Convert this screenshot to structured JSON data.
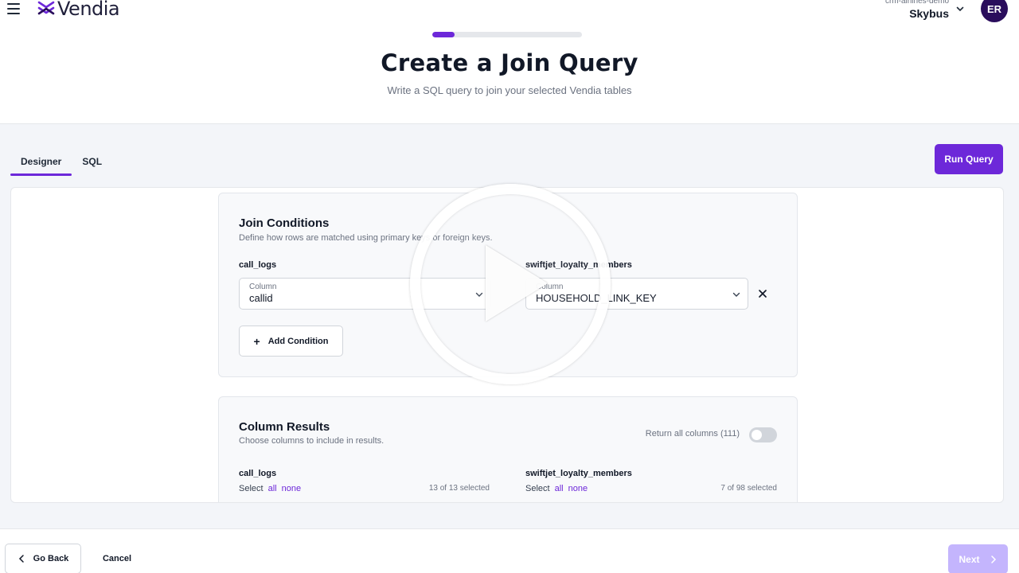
{
  "header": {
    "brand": "Vendia",
    "org_sub": "crm-airlines-demo",
    "org_name": "Skybus",
    "avatar_initials": "ER",
    "icons": {
      "menu": "hamburger-icon",
      "org_dropdown": "chevron-down-icon"
    }
  },
  "wizard": {
    "progress_fraction": 0.15,
    "title": "Create a Join Query",
    "subtitle": "Write a SQL query to join your selected Vendia tables"
  },
  "tabs": [
    {
      "label": "Designer",
      "active": true
    },
    {
      "label": "SQL",
      "active": false
    }
  ],
  "toolbar": {
    "run_label": "Run Query"
  },
  "join_conditions": {
    "title": "Join Conditions",
    "description": "Define how rows are matched using primary keys or foreign keys.",
    "left_table": "call_logs",
    "right_table": "swiftjet_loyalty_members",
    "conditions": [
      {
        "left": {
          "label": "Column",
          "value": "callid"
        },
        "right": {
          "label": "Column",
          "value": "HOUSEHOLD_LINK_KEY"
        }
      }
    ],
    "add_label": "Add Condition"
  },
  "column_results": {
    "title": "Column Results",
    "description": "Choose columns to include in results.",
    "return_all_label": "Return all columns (111)",
    "return_all_on": false,
    "tables": [
      {
        "name": "call_logs",
        "select_label": "Select",
        "all_label": "all",
        "none_label": "none",
        "count_text": "13 of 13 selected"
      },
      {
        "name": "swiftjet_loyalty_members",
        "select_label": "Select",
        "all_label": "all",
        "none_label": "none",
        "count_text": "7 of 98 selected"
      }
    ]
  },
  "footer": {
    "back_label": "Go Back",
    "cancel_label": "Cancel",
    "next_label": "Next"
  },
  "colors": {
    "accent": "#6d28d9",
    "accent_disabled": "#c4b5fd",
    "avatar_bg": "#2a0d5c",
    "workarea_bg": "#f3f5f9"
  }
}
